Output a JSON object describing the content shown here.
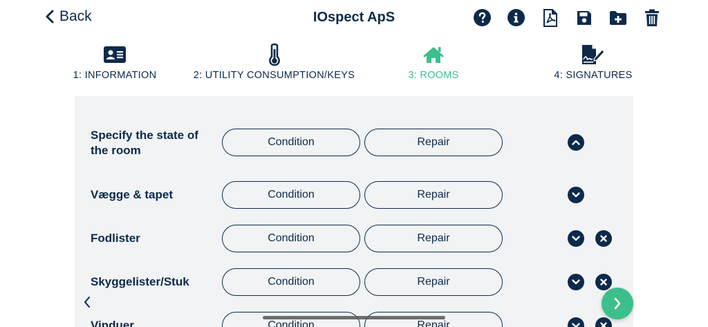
{
  "header": {
    "back_label": "Back",
    "title": "IOspect ApS"
  },
  "toolbar": {
    "icons": [
      "help-icon",
      "info-icon",
      "pdf-icon",
      "save-icon",
      "add-folder-icon",
      "trash-icon"
    ]
  },
  "tabs": [
    {
      "label": "1: INFORMATION",
      "icon": "id-card-icon",
      "active": false
    },
    {
      "label": "2: UTILITY CONSUMPTION/KEYS",
      "icon": "thermometer-icon",
      "active": false
    },
    {
      "label": "3: ROOMS",
      "icon": "home-icon",
      "active": true
    },
    {
      "label": "4: SIGNATURES",
      "icon": "signature-icon",
      "active": false
    }
  ],
  "rooms": {
    "header_row": {
      "label": "Specify the state of the room",
      "condition": "Condition",
      "repair": "Repair"
    },
    "rows": [
      {
        "label": "Vægge & tapet",
        "condition": "Condition",
        "repair": "Repair"
      },
      {
        "label": "Fodlister",
        "condition": "Condition",
        "repair": "Repair"
      },
      {
        "label": "Skyggelister/Stuk",
        "condition": "Condition",
        "repair": "Repair"
      },
      {
        "label": "Vinduer",
        "condition": "Condition",
        "repair": "Repair"
      }
    ]
  },
  "colors": {
    "primary": "#0d2a4a",
    "accent": "#3dbf8c",
    "panel_bg": "#f1f3f5"
  }
}
